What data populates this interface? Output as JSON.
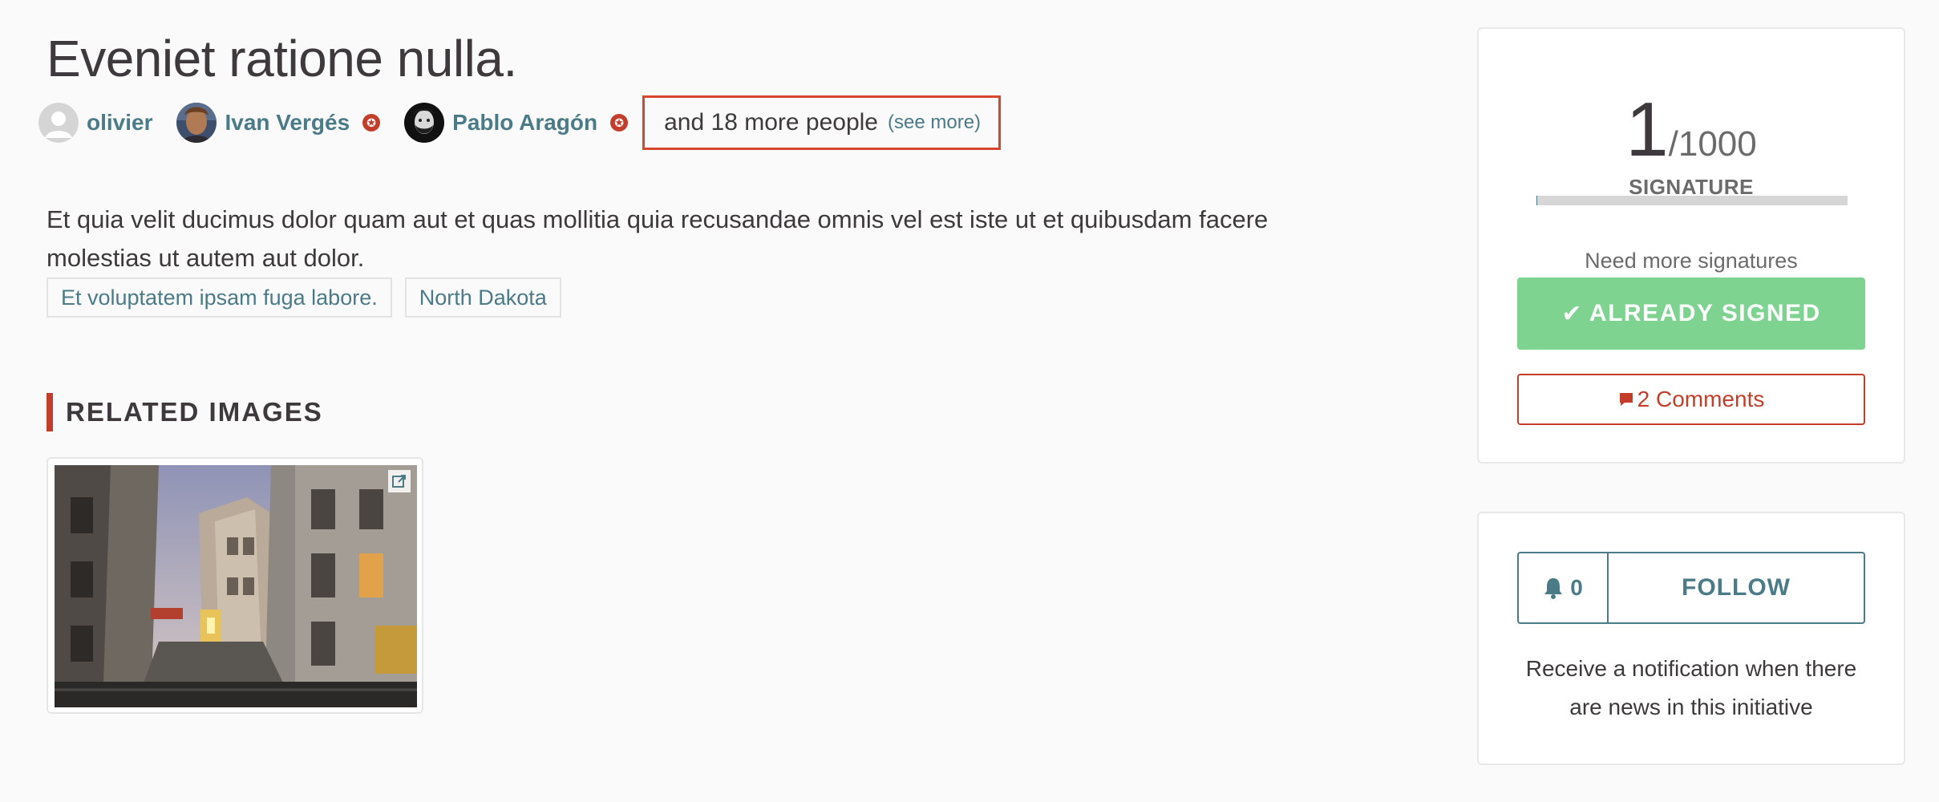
{
  "proposal": {
    "title": "Eveniet ratione nulla.",
    "authors": [
      {
        "name": "olivier",
        "avatar": "default-avatar-icon"
      },
      {
        "name": "Ivan Vergés",
        "avatar": "photo-avatar",
        "official": true
      },
      {
        "name": "Pablo Aragón",
        "avatar": "photo-avatar",
        "official": true
      }
    ],
    "more_people": "and 18 more people",
    "see_more": "(see more)",
    "body": "Et quia velit ducimus dolor quam aut et quas mollitia quia recusandae omnis vel est iste ut et quibusdam facere molestias ut autem aut dolor.",
    "tags": [
      "Et voluptatem ipsam fuga labore.",
      "North Dakota"
    ]
  },
  "related_images": {
    "heading": "RELATED IMAGES",
    "items": [
      {
        "icon": "external-link-icon"
      }
    ]
  },
  "signatures": {
    "count": "1",
    "total": "/1000",
    "label": "SIGNATURE",
    "progress": 0.001,
    "status": "Need more signatures",
    "signed_button": "ALREADY SIGNED",
    "signed_icon": "check-icon",
    "comments_button": "2 Comments",
    "comments_icon": "comment-icon"
  },
  "follow": {
    "count": "0",
    "count_icon": "bell-icon",
    "button": "FOLLOW",
    "note": "Receive a notification when there are news in this initiative"
  },
  "colors": {
    "link": "#4a7b87",
    "accent": "#c33e2a",
    "signed": "#7dd38f",
    "text": "#3d393c"
  }
}
